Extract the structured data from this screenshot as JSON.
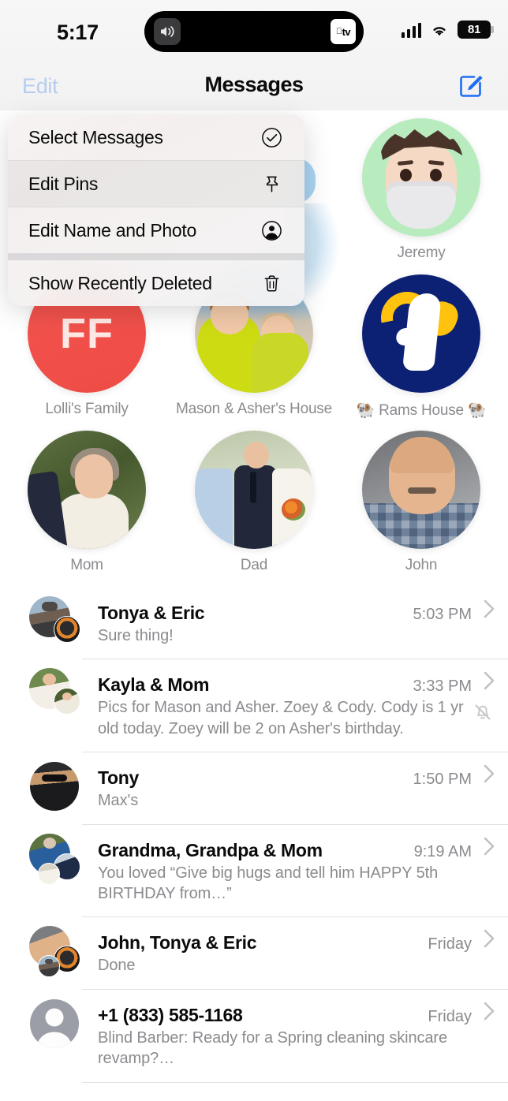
{
  "status_bar": {
    "time": "5:17",
    "speaker_icon": "speaker-wave-icon",
    "appletv_badge": "tv",
    "cellular_icon": "cellular-bars-icon",
    "wifi_icon": "wifi-icon",
    "battery_level": "81"
  },
  "nav": {
    "edit_label": "Edit",
    "title": "Messages",
    "compose_icon": "compose-pencil-icon",
    "edit_color": "#b6cdf0",
    "accent_color": "#1d6ef5"
  },
  "context_menu": {
    "items": [
      {
        "label": "Select Messages",
        "icon": "checkmark-circle-icon",
        "active": false
      },
      {
        "label": "Edit Pins",
        "icon": "pin-icon",
        "active": true
      },
      {
        "label": "Edit Name and Photo",
        "icon": "person-circle-icon",
        "active": false
      },
      {
        "label": "Show Recently Deleted",
        "icon": "trash-icon",
        "active": false
      }
    ]
  },
  "pinned": [
    {
      "label": "",
      "art": "hidden-behind-menu-1",
      "hidden": true
    },
    {
      "label": "",
      "art": "hidden-behind-menu-2",
      "hidden": true
    },
    {
      "label": "Jeremy",
      "art": "memoji-masked-avatar",
      "bg": "#b8ecbf"
    },
    {
      "label": "Lolli's Family",
      "art": "monogram-avatar",
      "monogram": "FF",
      "bg": "#ee4b45"
    },
    {
      "label": "Mason & Asher's House",
      "art": "photo-two-boys",
      "bg": "#8fb6d3"
    },
    {
      "label": "🐏 Rams House 🐏",
      "art": "rams-logo-avatar",
      "bg": "#0c2074"
    },
    {
      "label": "Mom",
      "art": "photo-mom",
      "bg": "#46592e"
    },
    {
      "label": "Dad",
      "art": "photo-wedding",
      "bg": "#cdd6bd"
    },
    {
      "label": "John",
      "art": "photo-john",
      "bg": "#8b8d90"
    }
  ],
  "conversations": [
    {
      "name": "Tonya & Eric",
      "time": "5:03 PM",
      "preview": "Sure thing!",
      "avatars": [
        "photo-tonya",
        "photo-eric"
      ],
      "muted": false
    },
    {
      "name": "Kayla & Mom",
      "time": "3:33 PM",
      "preview": "Pics for Mason and Asher. Zoey & Cody. Cody is 1 yr old today. Zoey will be 2 on Asher's birthday.",
      "avatars": [
        "photo-kayla",
        "photo-mom"
      ],
      "muted": true,
      "mute_icon": "bell-slash-icon"
    },
    {
      "name": "Tony",
      "time": "1:50 PM",
      "preview": "Max's",
      "avatars": [
        "photo-tony"
      ],
      "muted": false
    },
    {
      "name": "Grandma, Grandpa & Mom",
      "time": "9:19 AM",
      "preview": "You loved “Give big hugs and tell him HAPPY 5th BIRTHDAY from…”",
      "avatars": [
        "photo-grandma",
        "photo-grandpa",
        "photo-baby"
      ],
      "muted": false
    },
    {
      "name": "John, Tonya & Eric",
      "time": "Friday",
      "preview": "Done",
      "avatars": [
        "photo-john",
        "photo-eric",
        "photo-tonya"
      ],
      "muted": false
    },
    {
      "name": "+1 (833) 585-1168",
      "time": "Friday",
      "preview": "Blind Barber: Ready for a Spring cleaning skincare revamp?…",
      "avatars": [
        "generic-person-placeholder"
      ],
      "muted": false
    }
  ],
  "chevron_icon": "chevron-right-icon"
}
